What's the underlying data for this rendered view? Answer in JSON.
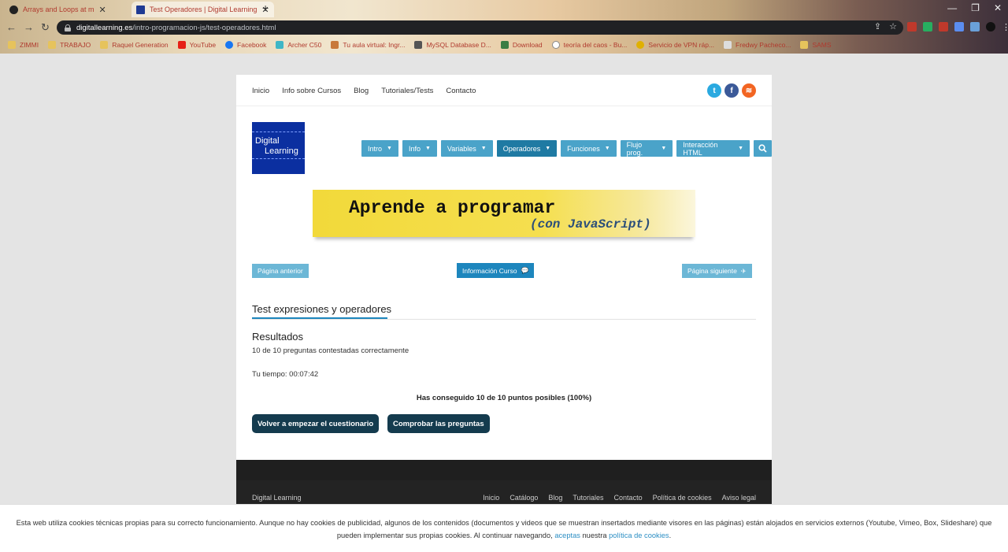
{
  "browser": {
    "tabs": [
      {
        "title": "Arrays and Loops at m",
        "active": false
      },
      {
        "title": "Test Operadores | Digital Learning",
        "active": true
      }
    ],
    "url_domain": "digitallearning.es",
    "url_path": "/intro-programacion-js/test-operadores.html",
    "bookmarks": [
      {
        "label": "ZIMMI",
        "icon": "folder"
      },
      {
        "label": "TRABAJO",
        "icon": "folder"
      },
      {
        "label": "Raquel Generation",
        "icon": "folder"
      },
      {
        "label": "YouTube",
        "icon": "youtube"
      },
      {
        "label": "Facebook",
        "icon": "facebook"
      },
      {
        "label": "Archer C50",
        "icon": "router"
      },
      {
        "label": "Tu aula virtual: Ingr...",
        "icon": "school"
      },
      {
        "label": "MySQL Database D...",
        "icon": "database"
      },
      {
        "label": "Download",
        "icon": "download"
      },
      {
        "label": "teoría del caos - Bu...",
        "icon": "google"
      },
      {
        "label": "Servicio de VPN ráp...",
        "icon": "vpn"
      },
      {
        "label": "Fredwy Pacheco...",
        "icon": "page"
      },
      {
        "label": "SAMS",
        "icon": "folder"
      }
    ]
  },
  "site": {
    "topnav": [
      "Inicio",
      "Info sobre Cursos",
      "Blog",
      "Tutoriales/Tests",
      "Contacto"
    ],
    "social": [
      "twitter-icon",
      "facebook-icon",
      "rss-icon"
    ],
    "logo": {
      "line1": "Digital",
      "line2": "Learning"
    },
    "mainnav": [
      {
        "label": "Intro",
        "active": false
      },
      {
        "label": "Info",
        "active": false
      },
      {
        "label": "Variables",
        "active": false
      },
      {
        "label": "Operadores",
        "active": true
      },
      {
        "label": "Funciones",
        "active": false
      },
      {
        "label": "Flujo prog.",
        "active": false
      },
      {
        "label": "Interacción HTML",
        "active": false
      }
    ],
    "banner": {
      "title": "Aprende a programar",
      "subtitle": "(con JavaScript)"
    },
    "buttons": {
      "prev": "Página anterior",
      "info": "Información Curso",
      "next": "Página siguiente"
    },
    "quiz": {
      "title": "Test expresiones y operadores",
      "results_heading": "Resultados",
      "results_summary": "10 de 10 preguntas contestadas correctamente",
      "time": "Tu tiempo: 00:07:42",
      "score": "Has conseguido 10 de 10 puntos posibles (100%)",
      "restart": "Volver a empezar el cuestionario",
      "check": "Comprobar las preguntas"
    },
    "footer": {
      "brand": "Digital Learning",
      "links": [
        "Inicio",
        "Catálogo",
        "Blog",
        "Tutoriales",
        "Contacto",
        "Política de cookies",
        "Aviso legal"
      ]
    }
  },
  "cookie_bar": {
    "text_1": "Esta web utiliza cookies técnicas propias para su correcto funcionamiento. Aunque no hay cookies de publicidad, algunos de los contenidos (documentos y videos que se muestran insertados mediante visores en las páginas) están alojados en servicios externos (Youtube, Vimeo, Box, Slideshare) que pueden implementar sus propias cookies. Al continuar navegando,",
    "link_accept": "aceptas",
    "text_2": "nuestra",
    "link_policy": "política de cookies",
    "text_3": "."
  },
  "colors": {
    "nav_blue": "#4aa3c9",
    "nav_active": "#1f7aa3",
    "logo_blue": "#0b2fa0",
    "banner_yellow": "#f2d93a",
    "action_button": "#143b4e",
    "footer_dark": "#232323"
  }
}
